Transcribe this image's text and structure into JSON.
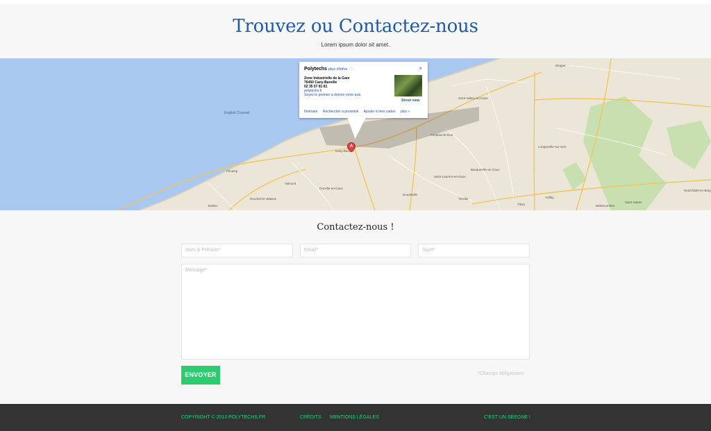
{
  "header": {
    "title": "Trouvez ou Contactez-nous",
    "subtitle": "Lorem ipsum dolor sit amet."
  },
  "map": {
    "sea_label": "English Channel",
    "towns": [
      "Fécamp",
      "Cany-Barville",
      "Doudeville",
      "Yerville",
      "Tôtes",
      "Dieppe",
      "Valmont",
      "Gruchet-le-Valasse",
      "Bolbec",
      "Fontaine-le-Dun",
      "Saint-Valery-en-Caux",
      "Neufchâtel-en-Bray",
      "Bellencombre",
      "Auffay",
      "Saint-Saëns",
      "Longueville-sur-Scie",
      "Bacqueville-en-Caux",
      "Ourville-en-Caux",
      "Saint-Laurent-en-Caux"
    ],
    "marker_letter": "A",
    "infowindow": {
      "name": "Polytechs",
      "more_info": "plus d'infos",
      "star": "☆",
      "close": "×",
      "address_line1": "Zone Industrielle de la Gare",
      "address_line2": "76450 Cany-Barville",
      "phone": "02 35 57 81 81",
      "website": "polytechs.fr",
      "review_link": "Soyez le premier à donner votre avis.",
      "street_view": "Street view",
      "actions": [
        "Itinéraire",
        "Rechercher à proximité",
        "Ajouter à mes cartes",
        "plus »"
      ]
    }
  },
  "contact": {
    "title": "Contactez-nous !",
    "name_placeholder": "Nom & Prénom*",
    "email_placeholder": "Email*",
    "subject_placeholder": "Sujet*",
    "message_placeholder": "Message*",
    "send_label": "ENVOYER",
    "required_note": "*Champs obligatoires"
  },
  "footer": {
    "copyright": "COPYRIGHT © 2013 POLYTECHS.FR",
    "credits": "CRÉDITS",
    "legal": "MENTIONS LÉGALES",
    "seegne": "C'EST UN SEEGNE !"
  },
  "colors": {
    "title_blue": "#1f5aa8",
    "accent_green": "#2ecc71",
    "footer_bg": "#333333",
    "sea": "#a8c8f0",
    "land": "#ece6d8"
  }
}
